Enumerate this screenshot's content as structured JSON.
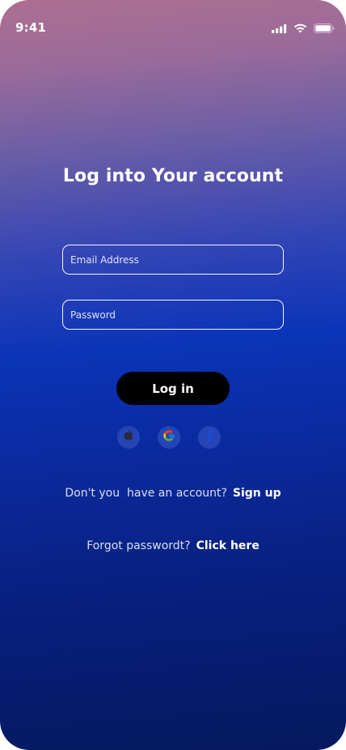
{
  "status_bar": {
    "time": "9:41",
    "icons": [
      "cellular-signal-icon",
      "wifi-icon",
      "battery-icon"
    ]
  },
  "login": {
    "title": "Log into Your account",
    "email_placeholder": "Email Address",
    "password_placeholder": "Password",
    "login_button": "Log in"
  },
  "social": [
    "apple-icon",
    "google-icon",
    "facebook-icon"
  ],
  "signup": {
    "prompt": "Don't you  have an account?",
    "link": "Sign up"
  },
  "forgot": {
    "prompt": "Forgot passwordt?",
    "link": "Click here"
  },
  "colors": {
    "gradient_top": "#ad6f91",
    "gradient_mid": "#0b34b8",
    "gradient_bottom": "#06195f",
    "button_bg": "#000000",
    "text": "#ffffff"
  }
}
